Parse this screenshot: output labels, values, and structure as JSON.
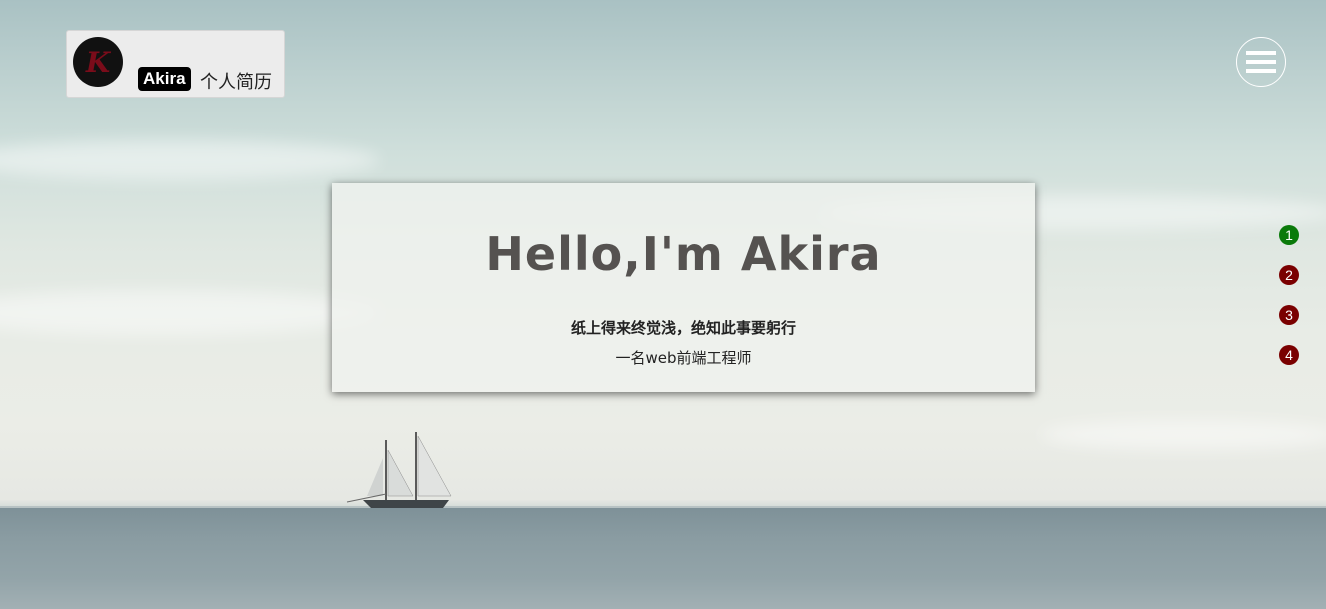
{
  "brand": {
    "logo_letter": "K",
    "badge": "Akira",
    "subtitle": "个人简历"
  },
  "menu": {
    "icon": "hamburger-menu-icon"
  },
  "hero": {
    "title": "Hello,I'm Akira",
    "motto": "纸上得来终觉浅，绝知此事要躬行",
    "role": "一名web前端工程师"
  },
  "page_nav": {
    "items": [
      {
        "label": "1",
        "active": true
      },
      {
        "label": "2",
        "active": false
      },
      {
        "label": "3",
        "active": false
      },
      {
        "label": "4",
        "active": false
      }
    ]
  },
  "colors": {
    "active_dot": "#0a7a0a",
    "inactive_dot": "#7a0000",
    "logo_letter": "#7a0c1a"
  }
}
